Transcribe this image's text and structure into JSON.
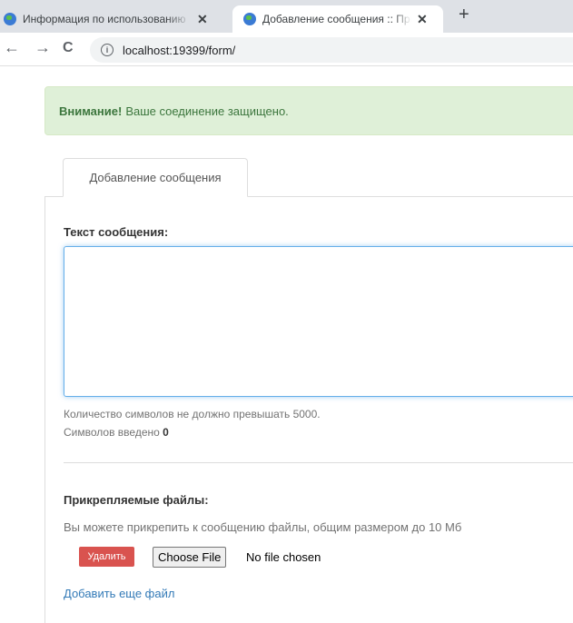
{
  "browser": {
    "tabs": [
      {
        "title": "Информация по использованию",
        "active": false
      },
      {
        "title": "Добавление сообщения :: Прием",
        "active": true
      }
    ],
    "url": "localhost:19399/form/"
  },
  "alert": {
    "strong": "Внимание!",
    "text": "Ваше соединение защищено."
  },
  "form_tab": {
    "label": "Добавление сообщения"
  },
  "message": {
    "label": "Текст сообщения:",
    "value": "",
    "limit_text": "Количество символов не должно превышать 5000.",
    "count_label": "Символов введено",
    "count": "0"
  },
  "attachments": {
    "label": "Прикрепляемые файлы:",
    "help": "Вы можете прикрепить к сообщению файлы, общим размером до 10 Мб",
    "delete_label": "Удалить",
    "choose_label": "Choose File",
    "no_file": "No file chosen",
    "add_more": "Добавить еще файл"
  },
  "colors": {
    "alert_bg": "#dff0d8",
    "alert_text": "#3c763d",
    "danger": "#d9534f",
    "link": "#337ab7",
    "focus": "#66afe9"
  }
}
